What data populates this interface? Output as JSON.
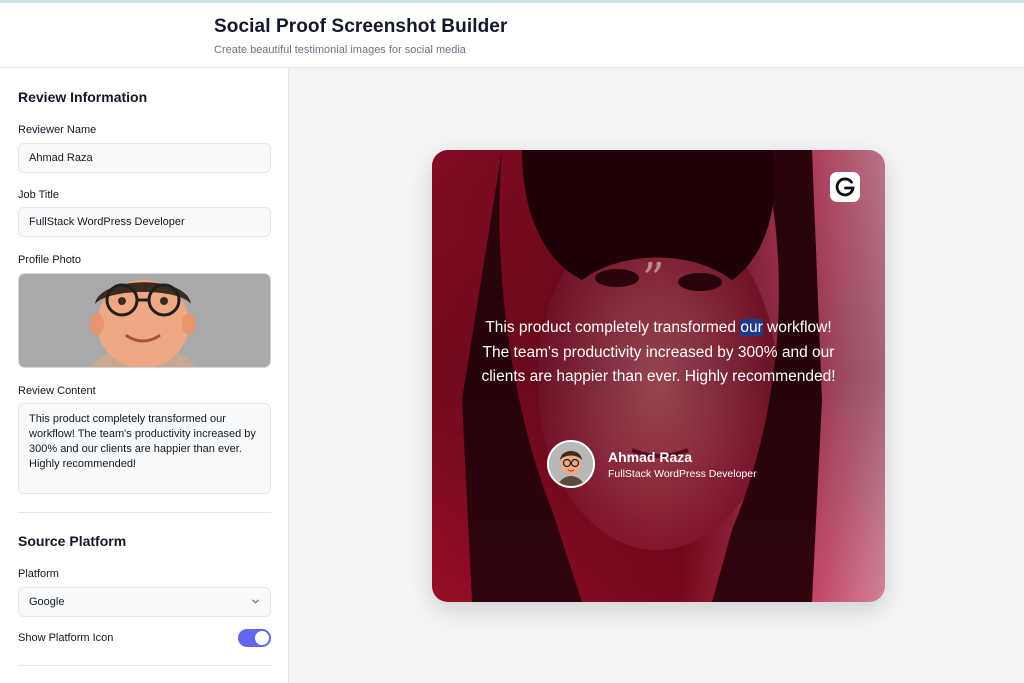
{
  "app": {
    "title": "Social Proof Screenshot Builder",
    "subtitle": "Create beautiful testimonial images for social media"
  },
  "review_section": {
    "title": "Review Information",
    "reviewer_name_label": "Reviewer Name",
    "reviewer_name_value": "Ahmad Raza",
    "job_title_label": "Job Title",
    "job_title_value": "FullStack WordPress Developer",
    "profile_photo_label": "Profile Photo",
    "review_content_label": "Review Content",
    "review_content_value": "This product completely transformed our workflow! The team's productivity increased by 300% and our clients are happier than ever. Highly recommended!"
  },
  "platform_section": {
    "title": "Source Platform",
    "platform_label": "Platform",
    "platform_value": "Google",
    "show_icon_label": "Show Platform Icon",
    "show_icon_enabled": true
  },
  "preview": {
    "platform_icon_letter": "G",
    "quote_mark": "”",
    "quote_before": "This product completely transformed ",
    "quote_highlight": "our",
    "quote_after": " workflow! The team's productivity increased by 300% and our clients are happier than ever. Highly recommended!",
    "author_name": "Ahmad Raza",
    "author_job": "FullStack WordPress Developer"
  },
  "colors": {
    "accent": "#6366f1",
    "card_tint": "#e11d48",
    "highlight": "#1e3a8a"
  }
}
